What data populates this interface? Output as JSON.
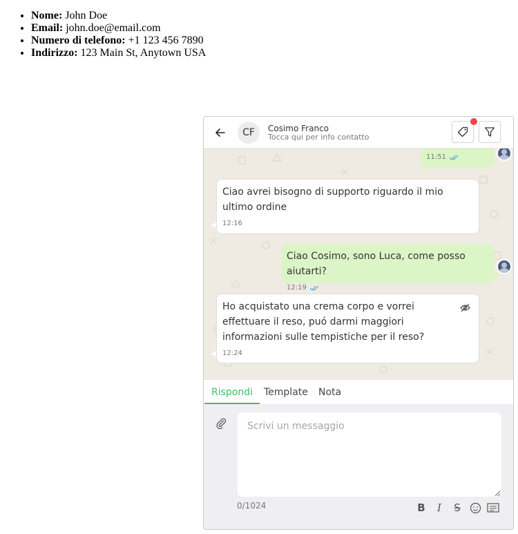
{
  "contact_info": [
    {
      "label": "Nome:",
      "value": " John Doe"
    },
    {
      "label": "Email:",
      "value": " john.doe@email.com"
    },
    {
      "label": "Numero di telefono:",
      "value": " +1 123 456 7890"
    },
    {
      "label": "Indirizzo:",
      "value": " 123 Main St, Anytown USA"
    }
  ],
  "chat": {
    "header": {
      "initials": "CF",
      "name": "Cosimo Franco",
      "subtitle": "Tocca qui per info contatto",
      "back_icon": "arrow-left-icon",
      "tag_icon": "tag-icon",
      "filter_icon": "filter-icon",
      "notify_color": "#f0454a"
    },
    "messages": [
      {
        "direction": "out",
        "text": "",
        "time": "11:51",
        "read": true
      },
      {
        "direction": "in",
        "text": "Ciao avrei bisogno di supporto riguardo il mio ultimo ordine",
        "time": "12:16"
      },
      {
        "direction": "out",
        "text": "Ciao Cosimo, sono Luca, come posso aiutarti?",
        "time": "12:19",
        "read": true
      },
      {
        "direction": "in",
        "text": "Ho acquistato una crema corpo e vorrei effettuare il reso, puó darmi maggiori informazioni sulle tempistiche per il reso?",
        "time": "12:24",
        "hidden_icon": "eye-off-icon"
      }
    ],
    "tabs": [
      {
        "label": "Rispondi",
        "active": true
      },
      {
        "label": "Template",
        "active": false
      },
      {
        "label": "Nota",
        "active": false
      }
    ],
    "composer": {
      "placeholder": "Scrivi un messaggio",
      "value": "",
      "counter": "0/1024",
      "toolbar": [
        "bold-icon",
        "italic-icon",
        "strikethrough-icon",
        "emoji-icon",
        "quick-reply-icon"
      ],
      "attach_icon": "paperclip-icon"
    },
    "colors": {
      "accent": "#3cc165",
      "outgoing_bubble": "#dcf5c6",
      "chat_background": "#efebe3",
      "read_tick": "#4fa3e0"
    }
  }
}
